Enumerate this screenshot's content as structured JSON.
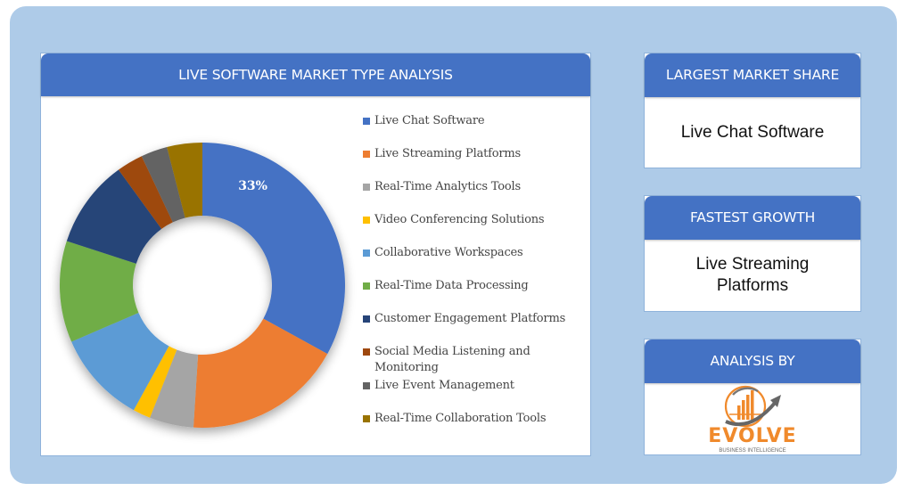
{
  "main_panel": {
    "title": "LIVE SOFTWARE MARKET TYPE ANALYSIS"
  },
  "side_panels": {
    "largest_market_share": {
      "title": "LARGEST MARKET SHARE",
      "value": "Live Chat Software"
    },
    "fastest_growth": {
      "title": "FASTEST GROWTH",
      "value": "Live Streaming Platforms"
    },
    "analysis_by": {
      "title": "ANALYSIS BY",
      "logo_text": "EVOLVE",
      "logo_subtext": "BUSINESS INTELLIGENCE",
      "logo_colors": {
        "primary": "#f08a2c",
        "secondary": "#666666"
      }
    }
  },
  "chart_data": {
    "type": "pie",
    "variant": "donut",
    "title": "LIVE SOFTWARE MARKET TYPE ANALYSIS",
    "categories": [
      "Live Chat Software",
      "Live Streaming Platforms",
      "Real-Time Analytics Tools",
      "Video Conferencing Solutions",
      "Collaborative Workspaces",
      "Real-Time Data Processing",
      "Customer Engagement Platforms",
      "Social Media Listening and Monitoring",
      "Live Event Management",
      "Real-Time Collaboration Tools"
    ],
    "values": [
      33,
      18,
      5,
      2,
      10.5,
      11.5,
      10,
      3,
      3,
      4
    ],
    "colors": [
      "#4472c4",
      "#ed7d31",
      "#a5a5a5",
      "#ffc000",
      "#5b9bd5",
      "#70ad47",
      "#264478",
      "#9e480e",
      "#636363",
      "#997300"
    ],
    "data_labels": [
      {
        "index": 0,
        "text": "33%"
      }
    ],
    "legend": "right",
    "start_angle": "12 o'clock, clockwise"
  }
}
